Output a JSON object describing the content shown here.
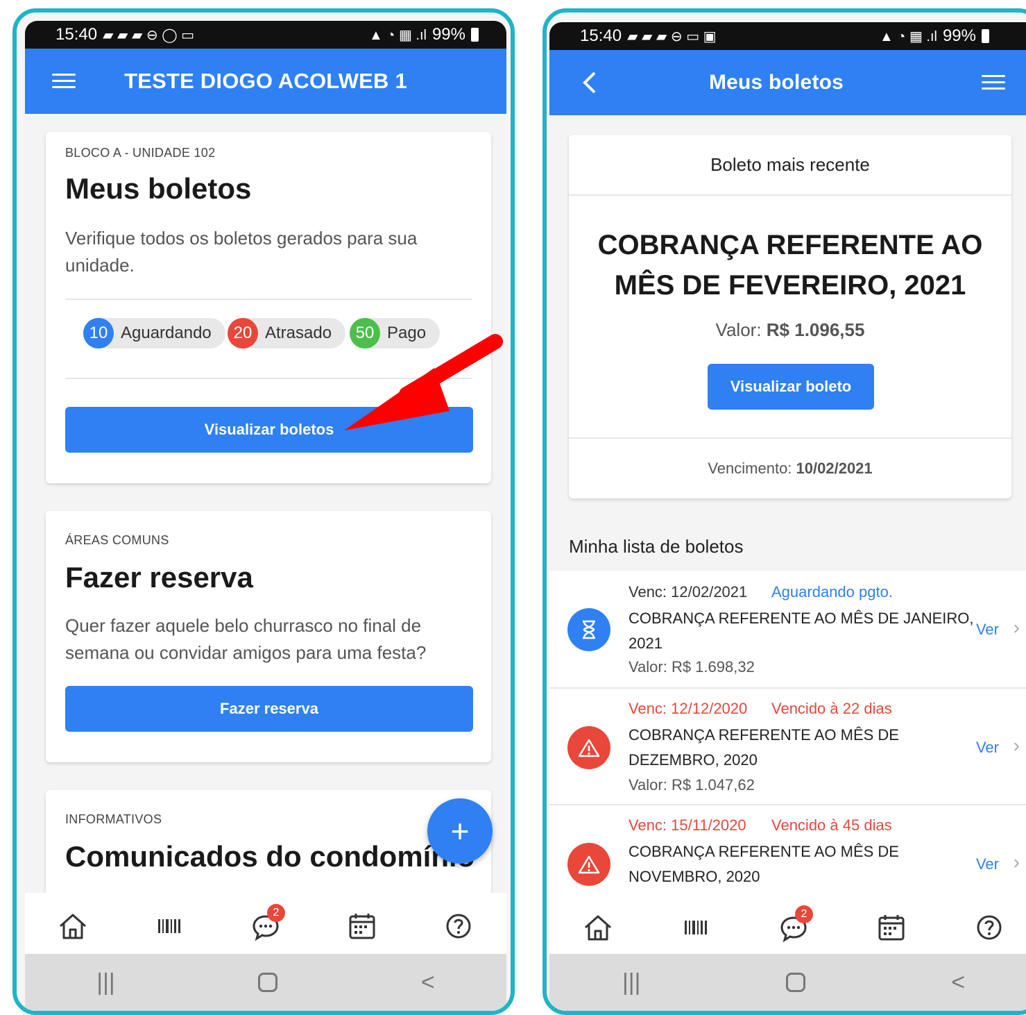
{
  "left": {
    "status": {
      "time": "15:40",
      "battery": "99%"
    },
    "appbar": {
      "title": "TESTE DIOGO ACOLWEB 1"
    },
    "boletos_card": {
      "eyebrow": "BLOCO A - UNIDADE 102",
      "title": "Meus boletos",
      "text": "Verifique todos os boletos gerados para sua unidade.",
      "chips": [
        {
          "count": "10",
          "label": "Aguardando",
          "color": "#2f80f2"
        },
        {
          "count": "20",
          "label": "Atrasado",
          "color": "#e8473a"
        },
        {
          "count": "50",
          "label": "Pago",
          "color": "#4cbf4a"
        }
      ],
      "button": "Visualizar boletos"
    },
    "reserva_card": {
      "eyebrow": "ÁREAS COMUNS",
      "title": "Fazer reserva",
      "text": "Quer fazer aquele belo churrasco no final de semana ou convidar amigos para uma festa?",
      "button": "Fazer reserva"
    },
    "info_card": {
      "eyebrow": "INFORMATIVOS",
      "title": "Comunicados do condomínio"
    },
    "fab": "+",
    "chat_badge": "2"
  },
  "right": {
    "status": {
      "time": "15:40",
      "battery": "99%"
    },
    "appbar": {
      "title": "Meus boletos"
    },
    "recent_card": {
      "header": "Boleto mais recente",
      "title": "COBRANÇA REFERENTE AO MÊS DE FEVEREIRO, 2021",
      "valor_label": "Valor:",
      "valor": "R$ 1.096,55",
      "button": "Visualizar boleto",
      "venc_label": "Vencimento:",
      "venc": "10/02/2021"
    },
    "list_title": "Minha lista de boletos",
    "items": [
      {
        "venc": "Venc: 12/02/2021",
        "status": "Aguardando pgto.",
        "desc1": "COBRANÇA REFERENTE AO MÊS DE JANEIRO,",
        "desc2": "2021",
        "valor": "Valor: R$ 1.698,32",
        "action": "Ver"
      },
      {
        "venc": "Venc: 12/12/2020",
        "status": "Vencido à 22 dias",
        "desc1": "COBRANÇA REFERENTE AO MÊS DE",
        "desc2": "DEZEMBRO, 2020",
        "valor": "Valor: R$ 1.047,62",
        "action": "Ver"
      },
      {
        "venc": "Venc: 15/11/2020",
        "status": "Vencido à 45 dias",
        "desc1": "COBRANÇA REFERENTE AO MÊS DE",
        "desc2": "NOVEMBRO, 2020",
        "valor": "",
        "action": "Ver"
      }
    ],
    "chat_badge": "2"
  },
  "colors": {
    "primary": "#2f80f2",
    "danger": "#e8473a",
    "success": "#4cbf4a",
    "frame": "#1fb4c6",
    "arrow": "#ff0000"
  }
}
